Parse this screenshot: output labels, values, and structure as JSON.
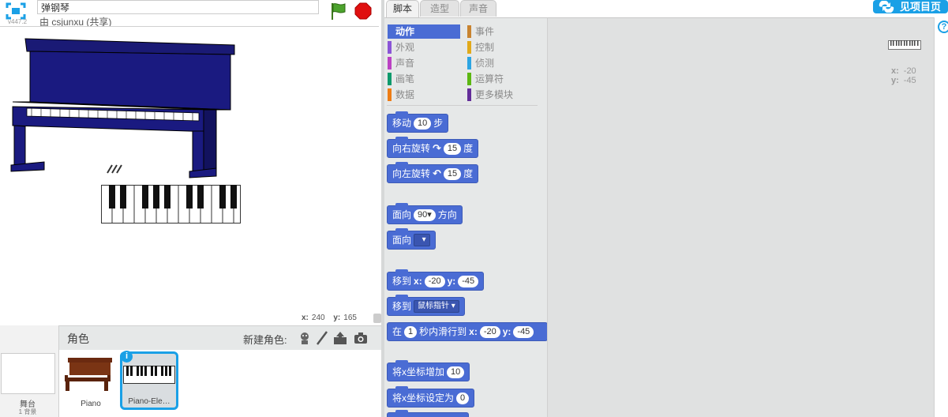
{
  "header": {
    "version": "v447.2",
    "project_title": "弹钢琴",
    "byline": "由 csjunxu (共享)"
  },
  "stage": {
    "mouse_x_label": "x:",
    "mouse_x": "240",
    "mouse_y_label": "y:",
    "mouse_y": "165"
  },
  "sprites_panel": {
    "title": "角色",
    "new_sprite_label": "新建角色:",
    "stage_label": "舞台",
    "stage_backdrops": "1 背景",
    "sprites": [
      {
        "name": "Piano"
      },
      {
        "name": "Piano-Ele…"
      }
    ],
    "info_badge": "i"
  },
  "tabs": [
    {
      "label": "脚本",
      "active": true
    },
    {
      "label": "造型",
      "active": false
    },
    {
      "label": "声音",
      "active": false
    }
  ],
  "see_project": {
    "label": "见项目页"
  },
  "categories": [
    {
      "label": "动作",
      "color": "#4a6cd4",
      "active": true
    },
    {
      "label": "事件",
      "color": "#c88330"
    },
    {
      "label": "外观",
      "color": "#8a55d7"
    },
    {
      "label": "控制",
      "color": "#e1a91a"
    },
    {
      "label": "声音",
      "color": "#bb42c3"
    },
    {
      "label": "侦测",
      "color": "#2ca5e2"
    },
    {
      "label": "画笔",
      "color": "#0e9a6c"
    },
    {
      "label": "运算符",
      "color": "#5cb712"
    },
    {
      "label": "数据",
      "color": "#ee7d16"
    },
    {
      "label": "更多模块",
      "color": "#632d99"
    }
  ],
  "blocks": {
    "move": {
      "text": "移动",
      "steps": "10",
      "suffix": "步"
    },
    "turn_right": {
      "text": "向右旋转",
      "degrees": "15",
      "suffix": "度"
    },
    "turn_left": {
      "text": "向左旋转",
      "degrees": "15",
      "suffix": "度"
    },
    "point_direction": {
      "text": "面向",
      "value": "90▾",
      "suffix": "方向"
    },
    "point_towards": {
      "text": "面向"
    },
    "go_to_xy": {
      "text": "移到",
      "x_label": "x:",
      "x": "-20",
      "y_label": "y:",
      "y": "-45"
    },
    "go_to": {
      "text": "移到",
      "target": "鼠标指针"
    },
    "glide": {
      "prefix": "在",
      "secs": "1",
      "text": "秒内滑行到",
      "x_label": "x:",
      "x": "-20",
      "y_label": "y:",
      "y": "-45"
    },
    "change_x": {
      "text": "将x坐标增加",
      "value": "10"
    },
    "set_x": {
      "text": "将x坐标设定为",
      "value": "0"
    }
  },
  "scripts_area": {
    "sprite_x_label": "x:",
    "sprite_x": "-20",
    "sprite_y_label": "y:",
    "sprite_y": "-45"
  },
  "help": {
    "icon_text": "?"
  }
}
